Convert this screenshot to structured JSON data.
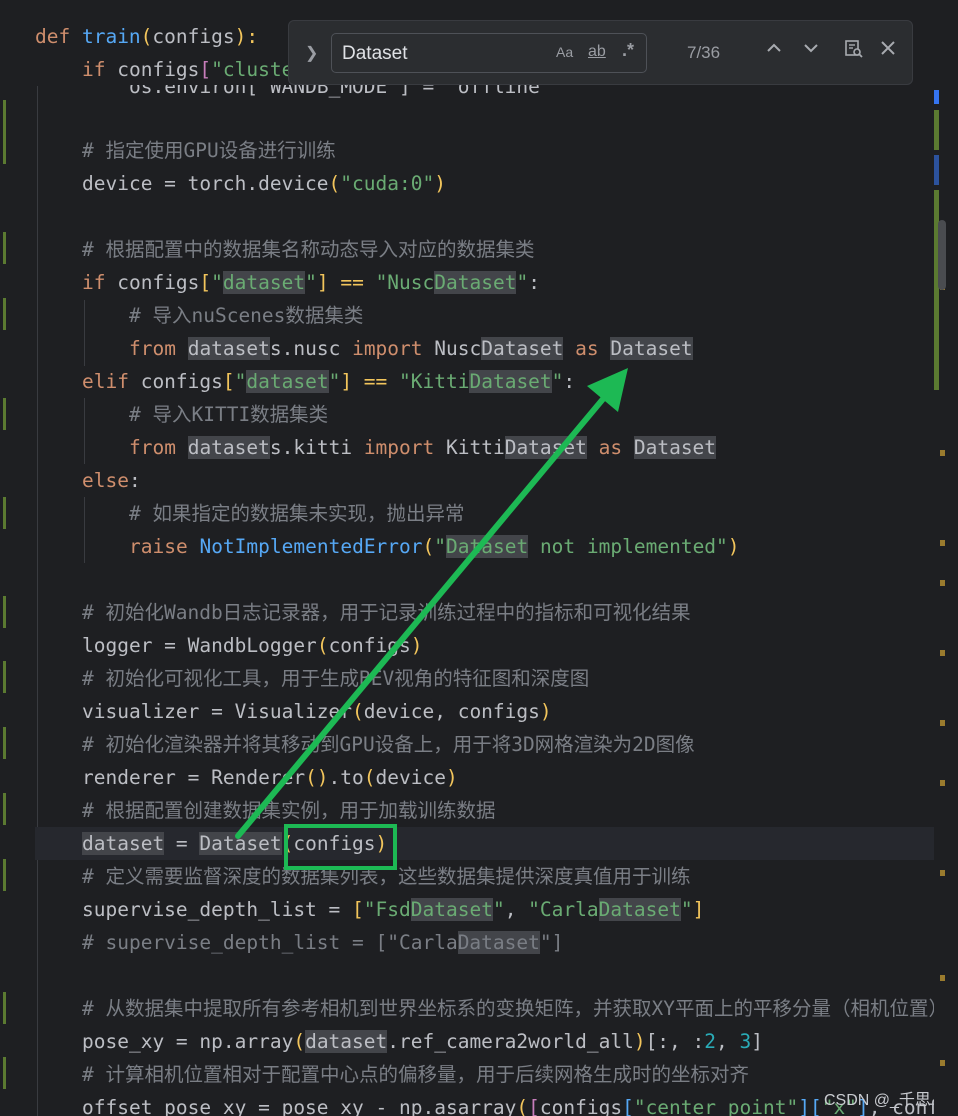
{
  "find": {
    "query": "Dataset",
    "match_case_label": "Aa",
    "whole_word_label": "ab",
    "regex_label": ".*",
    "count": "7/36"
  },
  "icons": {
    "expand": "chevron-right-icon",
    "prev": "arrow-up-icon",
    "next": "arrow-down-icon",
    "filter": "filter-search-icon",
    "close": "close-icon"
  },
  "code": {
    "l0": {
      "a": "def ",
      "b": "train",
      "c": "(",
      "d": "configs",
      "e": "):"
    },
    "l1": {
      "a": "if ",
      "b": "configs",
      "c": "[",
      "d": "\"cluste"
    },
    "l2": {
      "a": "os.environ[\"WANDB_MODE\"] = \"offline\""
    },
    "l3": {
      "a": "# 指定使用GPU设备进行训练"
    },
    "l4": {
      "a": "device = torch.device",
      "b": "(",
      "c": "\"cuda:0\"",
      "d": ")"
    },
    "l5": {
      "a": "# 根据配置中的数据集名称动态导入对应的数据集类"
    },
    "l6": {
      "a": "if ",
      "b": "configs",
      "c": "[",
      "d": "\"",
      "e": "dataset",
      "f": "\"",
      "g": "] == ",
      "h": "\"Nusc",
      "i": "Dataset",
      "j": "\"",
      "k": ":"
    },
    "l7": {
      "a": "# 导入nuScenes数据集类"
    },
    "l8": {
      "a": "from ",
      "b": "dataset",
      "c": "s.nusc ",
      "d": "import ",
      "e": "Nusc",
      "f": "Dataset",
      "g": " as ",
      "h": "Dataset"
    },
    "l9": {
      "a": "elif ",
      "b": "configs",
      "c": "[",
      "d": "\"",
      "e": "dataset",
      "f": "\"",
      "g": "] == ",
      "h": "\"Kitti",
      "i": "Dataset",
      "j": "\"",
      "k": ":"
    },
    "l10": {
      "a": "# 导入KITTI数据集类"
    },
    "l11": {
      "a": "from ",
      "b": "dataset",
      "c": "s.kitti ",
      "d": "import ",
      "e": "Kitti",
      "f": "Dataset",
      "g": " as ",
      "h": "Dataset"
    },
    "l12": {
      "a": "else",
      "b": ":"
    },
    "l13": {
      "a": "# 如果指定的数据集未实现，抛出异常"
    },
    "l14": {
      "a": "raise ",
      "b": "NotImplementedError",
      "c": "(",
      "d": "\"",
      "e": "Dataset",
      "f": " not implemented\"",
      "g": ")"
    },
    "l15": {
      "a": "# 初始化Wandb日志记录器，用于记录训练过程中的指标和可视化结果"
    },
    "l16": {
      "a": "logger = WandbLogger",
      "b": "(",
      "c": "configs",
      "d": ")"
    },
    "l17": {
      "a": "# 初始化可视化工具，用于生成BEV视角的特征图和深度图"
    },
    "l18": {
      "a": "visualizer = Visualizer",
      "b": "(",
      "c": "device, configs",
      "d": ")"
    },
    "l19": {
      "a": "# 初始化渲染器并将其移动到GPU设备上，用于将3D网格渲染为2D图像"
    },
    "l20": {
      "a": "renderer = Renderer",
      "b": "()",
      "c": ".to",
      "d": "(",
      "e": "device",
      "f": ")"
    },
    "l21": {
      "a": "# 根据配置创建数据集实例，用于加载训练数据"
    },
    "l22": {
      "a": "dataset",
      "b": " = ",
      "c": "Dataset",
      "d": "(",
      "e": "configs",
      "f": ")"
    },
    "l23": {
      "a": "# 定义需要监督深度的数据集列表，这些数据集提供深度真值用于训练"
    },
    "l24": {
      "a": "supervise_depth_list = ",
      "b": "[",
      "c": "\"Fsd",
      "d": "Dataset",
      "e": "\"",
      "f": ", ",
      "g": "\"Carla",
      "h": "Dataset",
      "i": "\"",
      "j": "]"
    },
    "l25": {
      "a": "# supervise_depth_list = [\"Carla",
      "b": "Dataset",
      "c": "\"]"
    },
    "l26": {
      "a": "# 从数据集中提取所有参考相机到世界坐标系的变换矩阵，并获取XY平面上的平移分量（相机位置）"
    },
    "l27": {
      "a": "pose_xy = np.array",
      "b": "(",
      "c": "dataset",
      "d": ".ref_camera2world_all",
      "e": ")",
      "f": "[:, :",
      "g": "2",
      "h": ", ",
      "i": "3",
      "j": "]"
    },
    "l28": {
      "a": "# 计算相机位置相对于配置中心点的偏移量，用于后续网格生成时的坐标对齐"
    },
    "l29": {
      "a": "offset_pose_xy = pose_xy - np.asarray",
      "b": "(",
      "c": "[",
      "d": "configs",
      "e": "[",
      "f": "\"center_point\"",
      "g": "]",
      "h": "[",
      "i": "\"x\"",
      "j": "]",
      "k": ", configs"
    }
  },
  "watermark": "CSDN @_千思",
  "colors": {
    "background": "#1e1f22",
    "keyword": "#cf8e6d",
    "function": "#56a8f5",
    "string": "#6aab73",
    "comment": "#7a7e85",
    "annotation": "#1db954"
  }
}
